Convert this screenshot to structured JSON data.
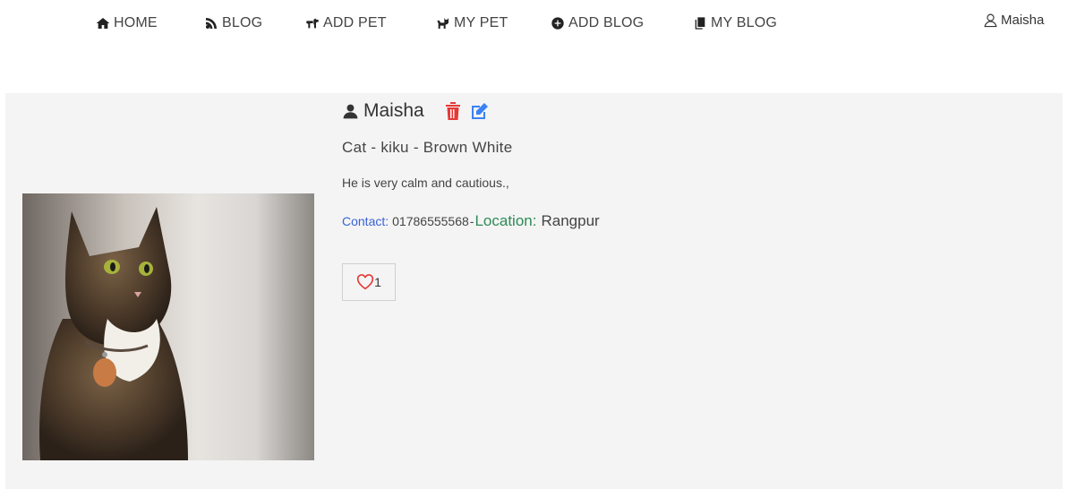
{
  "nav": {
    "items": [
      {
        "label": "HOME",
        "icon": "home-icon"
      },
      {
        "label": "BLOG",
        "icon": "feed-icon"
      },
      {
        "label": "ADD PET",
        "icon": "dog-icon"
      },
      {
        "label": "MY PET",
        "icon": "cat-icon"
      },
      {
        "label": "ADD BLOG",
        "icon": "plus-circle-icon"
      },
      {
        "label": "MY BLOG",
        "icon": "copy-icon"
      }
    ],
    "user": {
      "name": "Maisha",
      "icon": "user-outline-icon"
    }
  },
  "post": {
    "owner": "Maisha",
    "pet_line": "Cat - kiku - Brown White",
    "description": "He is very calm and cautious.,",
    "contact_label": "Contact:",
    "contact_value": "01786555568",
    "separator": "-",
    "location_label": "Location:",
    "location_value": "Rangpur",
    "likes": "1"
  },
  "colors": {
    "panel_bg": "#f4f4f4",
    "delete": "#e53935",
    "edit": "#3b82f6",
    "contact_label": "#3a63d6",
    "location_label": "#2e8b57",
    "heart": "#e53935"
  }
}
